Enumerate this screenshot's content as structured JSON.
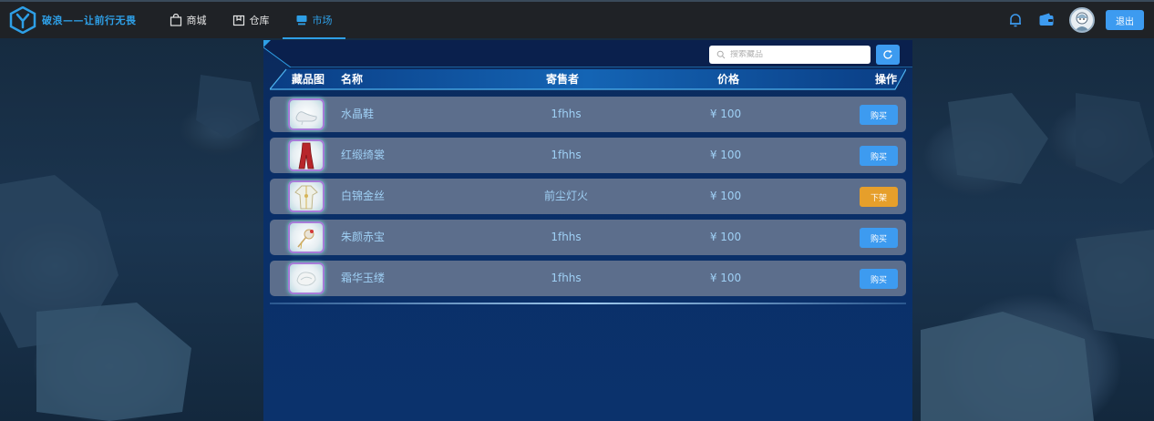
{
  "app": {
    "logo_text": "破浪——让前行无畏",
    "nav": [
      {
        "label": "商城",
        "icon": "shopping-bag-icon"
      },
      {
        "label": "仓库",
        "icon": "package-icon"
      },
      {
        "label": "市场",
        "icon": "market-icon"
      }
    ],
    "active_nav": "市场",
    "logout_label": "退出"
  },
  "market": {
    "search_placeholder": "搜索藏品",
    "columns": {
      "image": "藏品图",
      "name": "名称",
      "seller": "寄售者",
      "price": "价格",
      "action": "操作"
    },
    "rows": [
      {
        "name": "水晶鞋",
        "seller": "1fhhs",
        "price": "¥ 100",
        "action": "购买",
        "action_type": "buy",
        "icon": "crystal-shoe-icon"
      },
      {
        "name": "红缎绮裳",
        "seller": "1fhhs",
        "price": "¥ 100",
        "action": "购买",
        "action_type": "buy",
        "icon": "red-dress-icon"
      },
      {
        "name": "白锦金丝",
        "seller": "前尘灯火",
        "price": "¥ 100",
        "action": "下架",
        "action_type": "unlist",
        "icon": "white-robe-icon"
      },
      {
        "name": "朱颜赤宝",
        "seller": "1fhhs",
        "price": "¥ 100",
        "action": "购买",
        "action_type": "buy",
        "icon": "hairpin-icon"
      },
      {
        "name": "霜华玉缕",
        "seller": "1fhhs",
        "price": "¥ 100",
        "action": "购买",
        "action_type": "buy",
        "icon": "jade-ornament-icon"
      }
    ]
  },
  "colors": {
    "accent": "#3d9bf0",
    "unlist": "#e69f2b",
    "row_bg": "#5c6e8c",
    "text_light": "#9fd0f5"
  }
}
